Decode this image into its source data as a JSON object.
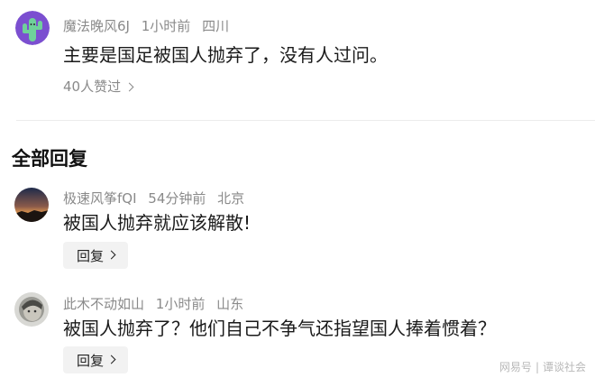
{
  "top_comment": {
    "username": "魔法晚风6J",
    "time": "1小时前",
    "location": "四川",
    "content": "主要是国足被国人抛弃了，没有人过问。",
    "likes_text": "40人赞过"
  },
  "replies_section": {
    "title": "全部回复",
    "replies": [
      {
        "username": "极速风筝fQI",
        "time": "54分钟前",
        "location": "北京",
        "content": "被国人抛弃就应该解散!",
        "reply_label": "回复"
      },
      {
        "username": "此木不动如山",
        "time": "1小时前",
        "location": "山东",
        "content": "被国人抛弃了？他们自己不争气还指望国人捧着惯着？",
        "reply_label": "回复"
      }
    ]
  },
  "watermark": {
    "left": "网易号",
    "right": "谭谈社会"
  },
  "colors": {
    "meta_text": "#8a8a8a",
    "reply_button_bg": "#f2f2f2",
    "divider": "#ececec"
  }
}
